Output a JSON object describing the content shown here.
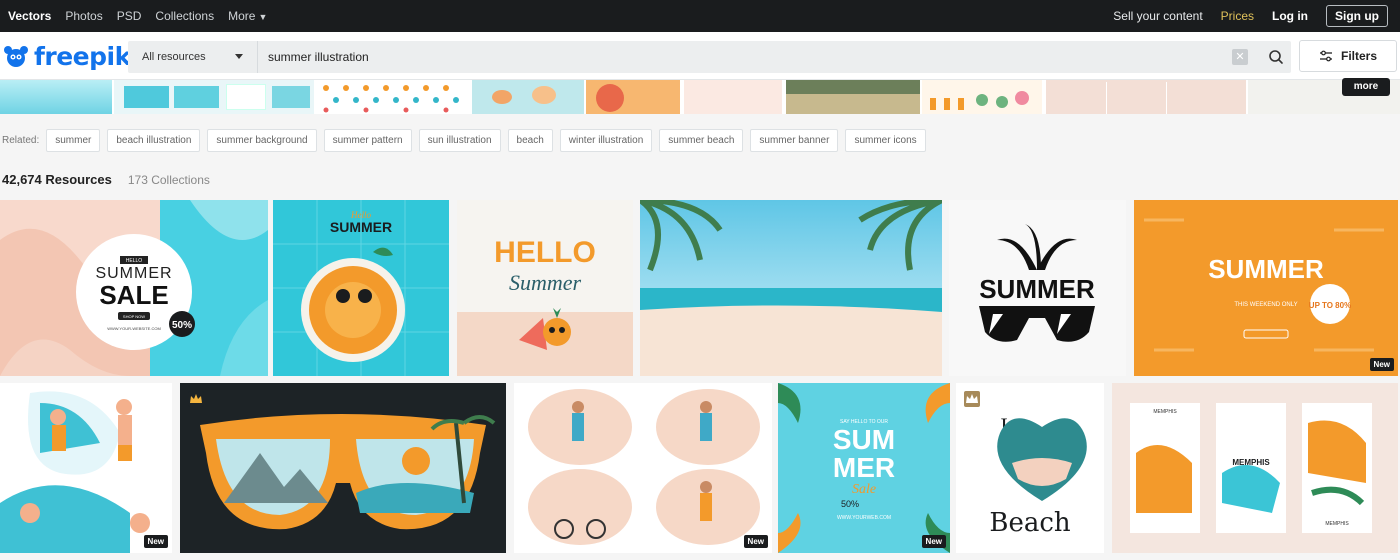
{
  "topnav": {
    "items": [
      "Vectors",
      "Photos",
      "PSD",
      "Collections",
      "More"
    ],
    "sell": "Sell your content",
    "prices": "Prices",
    "login": "Log in",
    "signup": "Sign up"
  },
  "brand": "freepik",
  "search": {
    "category": "All resources",
    "query": "summer illustration"
  },
  "filters_label": "Filters",
  "strip_more": "more",
  "related": {
    "label": "Related:",
    "tags": [
      "summer",
      "beach illustration",
      "summer background",
      "summer pattern",
      "sun illustration",
      "beach",
      "winter illustration",
      "summer beach",
      "summer banner",
      "summer icons"
    ]
  },
  "counts": {
    "resources": "42,674 Resources",
    "collections": "173 Collections"
  },
  "cards": {
    "c1": {
      "hello": "HELLO",
      "line1": "SUMMER",
      "line2": "SALE",
      "pct": "50%",
      "btn": "SHOP NOW",
      "site": "WWW.YOUR-WEBSITE.COM"
    },
    "c2": {
      "hello": "Hello",
      "title": "SUMMER"
    },
    "c3": {
      "hello": "HELLO",
      "script": "Summer"
    },
    "c5": {
      "title": "SUMMER"
    },
    "c6": {
      "title": "SUMMER",
      "sub": "THIS WEEKEND ONLY",
      "pct": "UP TO 80%",
      "badge": "New"
    },
    "c8": {
      "badge": "New"
    },
    "c9": {
      "badge": "New"
    },
    "c10": {
      "top": "SAY HELLO TO OUR",
      "l1": "SUM",
      "l2": "MER",
      "sale": "Sale",
      "pct": "50%",
      "site": "WWW.YOURWEB.COM",
      "badge": "New"
    },
    "c11": {
      "i": "I",
      "beach": "Beach"
    },
    "c12": {
      "m1": "MEMPHIS",
      "m2": "MEMPHIS",
      "m3": "MEMPHIS"
    }
  },
  "colors": {
    "brand_blue": "#1273eb",
    "nav_bg": "#1a1c1e",
    "prices": "#e0c15a",
    "orange": "#f39a2b",
    "teal": "#3ccfe0"
  }
}
